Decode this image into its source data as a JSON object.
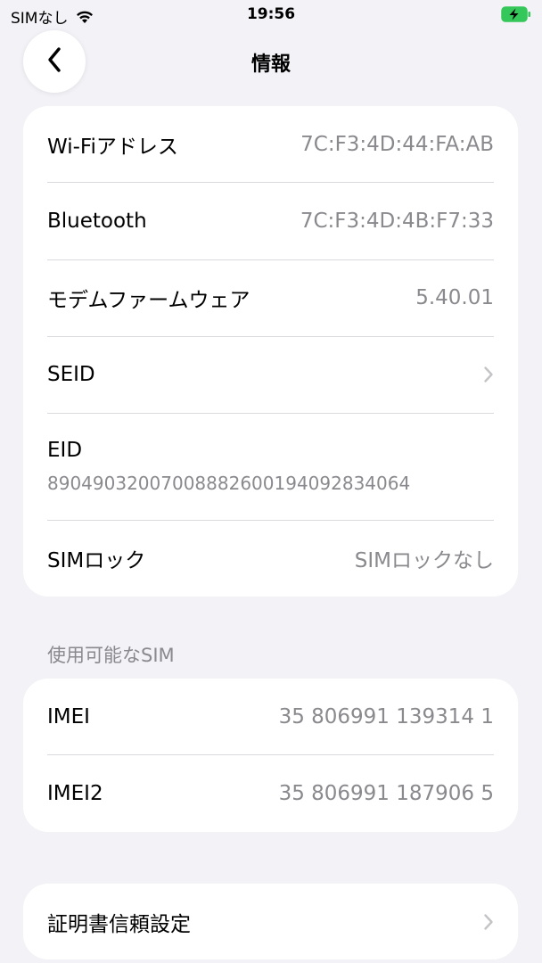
{
  "status_bar": {
    "carrier": "SIMなし",
    "time": "19:56",
    "icons": [
      "wifi-icon",
      "battery-charging-icon"
    ],
    "battery_color": "#34c759"
  },
  "nav": {
    "title": "情報",
    "back_icon": "chevron-left-icon"
  },
  "info_group": {
    "rows": [
      {
        "label": "Wi-Fiアドレス",
        "value": "7C:F3:4D:44:FA:AB"
      },
      {
        "label": "Bluetooth",
        "value": "7C:F3:4D:4B:F7:33"
      },
      {
        "label": "モデムファームウェア",
        "value": "5.40.01"
      },
      {
        "label": "SEID",
        "icon": "chevron-right-icon"
      },
      {
        "label": "EID",
        "value": "89049032007008882600194092834064"
      },
      {
        "label": "SIMロック",
        "value": "SIMロックなし"
      }
    ]
  },
  "sim_section": {
    "header": "使用可能なSIM",
    "rows": [
      {
        "label": "IMEI",
        "value": "35 806991 139314 1"
      },
      {
        "label": "IMEI2",
        "value": "35 806991 187906 5"
      }
    ]
  },
  "cert_group": {
    "rows": [
      {
        "label": "証明書信頼設定",
        "icon": "chevron-right-icon"
      }
    ]
  }
}
